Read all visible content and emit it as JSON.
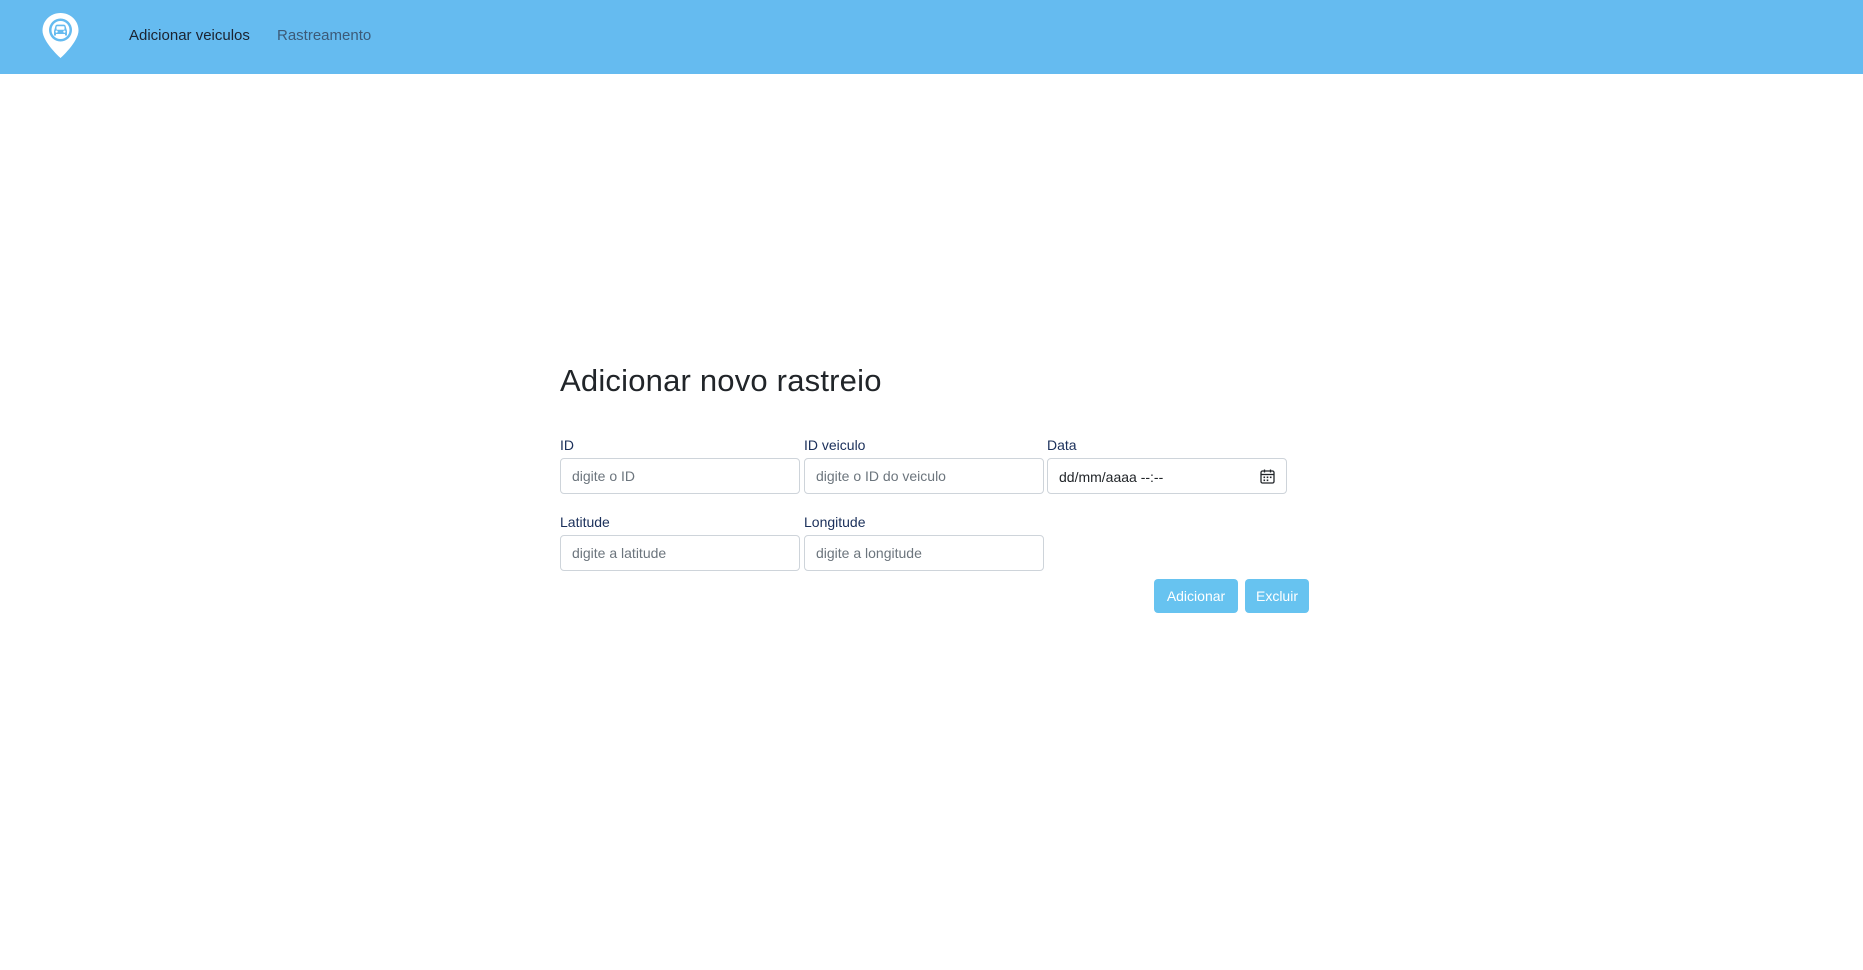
{
  "nav": {
    "logo_icon": "car-location-pin-icon",
    "links": [
      {
        "label": "Adicionar veiculos",
        "active": true
      },
      {
        "label": "Rastreamento",
        "active": false
      }
    ]
  },
  "form": {
    "title": "Adicionar novo rastreio",
    "fields": {
      "id": {
        "label": "ID",
        "placeholder": "digite o ID"
      },
      "vehicle_id": {
        "label": "ID veiculo",
        "placeholder": "digite o ID do veiculo"
      },
      "date": {
        "label": "Data",
        "value": "dd/mm/aaaa --:--",
        "icon": "calendar-icon"
      },
      "latitude": {
        "label": "Latitude",
        "placeholder": "digite a latitude"
      },
      "longitude": {
        "label": "Longitude",
        "placeholder": "digite a longitude"
      }
    },
    "buttons": {
      "add": "Adicionar",
      "delete": "Excluir"
    }
  },
  "colors": {
    "navbar": "#65bbf0",
    "button": "#67c3f0",
    "label": "#1a2f5a"
  }
}
